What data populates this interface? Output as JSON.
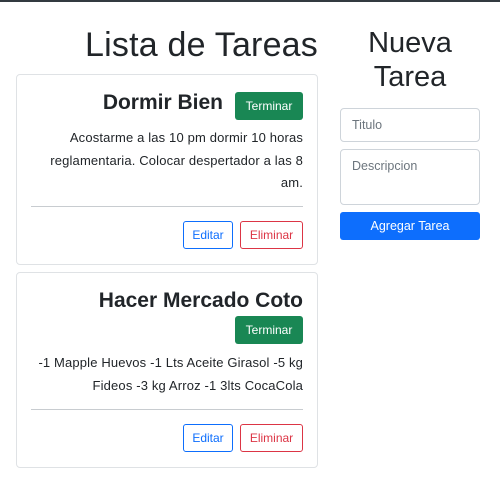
{
  "list": {
    "heading": "Lista de Tareas",
    "tasks": [
      {
        "title": "Dormir Bien",
        "description": "Acostarme a las 10 pm dormir 10 horas reglamentaria. Colocar despertador a las 8 am.",
        "finish_label": "Terminar",
        "edit_label": "Editar",
        "delete_label": "Eliminar"
      },
      {
        "title": "Hacer Mercado Coto",
        "description": "-1 Mapple Huevos -1 Lts Aceite Girasol -5 kg Fideos -3 kg Arroz -1 3lts CocaCola",
        "finish_label": "Terminar",
        "edit_label": "Editar",
        "delete_label": "Eliminar"
      }
    ]
  },
  "new_task": {
    "heading_line1": "Nueva",
    "heading_line2": "Tarea",
    "title_placeholder": "Titulo",
    "description_placeholder": "Descripcion",
    "submit_label": "Agregar Tarea"
  },
  "colors": {
    "primary": "#0d6efd",
    "success": "#198754",
    "danger": "#dc3545",
    "border": "#dfe2e5"
  }
}
